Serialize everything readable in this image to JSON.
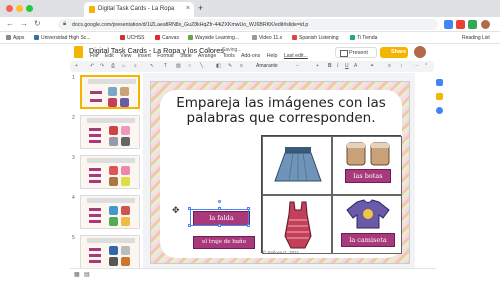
{
  "browser": {
    "tab_title": "Digital Task Cards - La Ropa",
    "new_tab": "+",
    "url": "docs.google.com/presentation/d/1iZLaeafiRN8x_GuZ8kHqZfr-44iZXKmwUo_WJ6BRKK/edit#slide=id.p",
    "bookmarks": [
      "Apps",
      "Universidad High Sc...",
      "UCHSS",
      "Canvas",
      "Wayside Learning...",
      "Video 11.x",
      "Spanish Listening",
      "Ti Tienda",
      "Reading List"
    ]
  },
  "docs": {
    "title": "Digital Task Cards - La Ropa y los Colores",
    "saving": "Saving...",
    "present_label": "Present",
    "share_label": "Share",
    "menu": [
      "File",
      "Edit",
      "View",
      "Insert",
      "Format",
      "Slide",
      "Arrange",
      "Tools",
      "Add-ons",
      "Help",
      "Last edit..."
    ],
    "font": "Amarante"
  },
  "filmstrip": {
    "slide_numbers": [
      "1",
      "2",
      "3",
      "4",
      "5",
      "6"
    ]
  },
  "slide": {
    "title": "Empareja las imágenes con las palabras que corresponden.",
    "words": {
      "falda": "la falda",
      "traje": "el traje de baño",
      "botas": "las botas",
      "camiseta": "la camiseta"
    },
    "copyright": "© Señora G. 2021"
  },
  "colors": {
    "label_bg": "#a83a7c",
    "accent": "#f4b400",
    "selection": "#4285f4"
  }
}
